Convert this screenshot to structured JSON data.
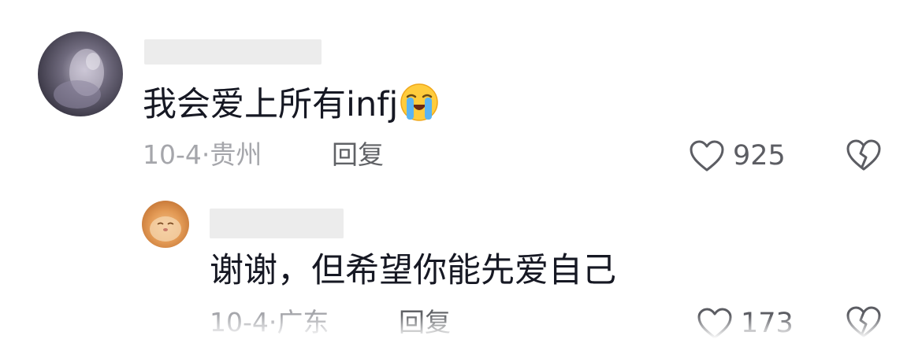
{
  "comment": {
    "text": "我会爱上所有infj",
    "emoji": "loudly-crying-face",
    "date": "10-4",
    "location": "贵州",
    "reply_label": "回复",
    "like_count": "925"
  },
  "reply": {
    "text": "谢谢，但希望你能先爱自己",
    "date": "10-4",
    "location": "广东",
    "reply_label": "回复",
    "like_count": "173"
  },
  "meta_separator": "·",
  "colors": {
    "text": "#161823",
    "meta": "#a5a6ab",
    "reply_button": "#606266",
    "icon": "#5c5d63"
  }
}
